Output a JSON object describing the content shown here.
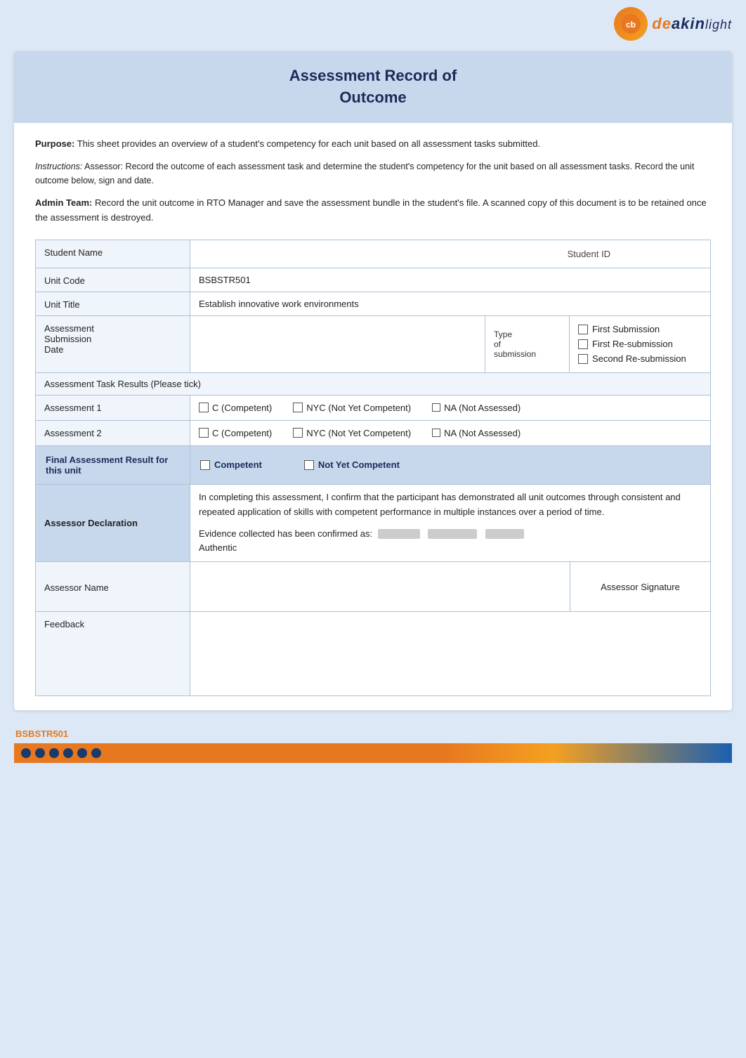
{
  "header": {
    "logo_text": "deakin"
  },
  "title": {
    "line1": "Assessment Record of",
    "line2": "Outcome"
  },
  "purpose": {
    "label": "Purpose:",
    "text": " This sheet provides an overview of a student's competency for each unit based on all assessment tasks submitted."
  },
  "instructions": {
    "label": "Instructions:",
    "assessor_label": " Assessor:",
    "text": " Record the outcome of each assessment task and determine the student's competency for the unit based on all assessment tasks. Record the unit outcome below, sign and date."
  },
  "admin": {
    "label": "Admin Team:",
    "text": " Record the unit outcome in RTO Manager and save the assessment bundle in the student's file. A scanned copy of this document is to be retained once the assessment is destroyed."
  },
  "form": {
    "student_name_label": "Student Name",
    "student_id_label": "Student ID",
    "unit_code_label": "Unit Code",
    "unit_code_value": "BSBSTR501",
    "unit_title_label": "Unit Title",
    "unit_title_value": "Establish innovative work environments",
    "assessment_submission_date_label": "Assessment Submission Date",
    "type_submission_label": "Type",
    "of_label": "of",
    "submission_label": "submission",
    "submission_options": [
      {
        "label": "First Submission",
        "checked": false
      },
      {
        "label": "First Re-submission",
        "checked": false
      },
      {
        "label": "Second Re-submission",
        "checked": false
      }
    ],
    "task_results_label": "Assessment Task Results (Please tick)",
    "assessment1_label": "Assessment 1",
    "assessment2_label": "Assessment 2",
    "option_c": "C (Competent)",
    "option_nyc": "NYC (Not Yet Competent)",
    "option_na": "NA (Not Assessed)",
    "final_result_label": "Final Assessment Result for this unit",
    "final_competent": "Competent",
    "final_nyc": "Not Yet Competent",
    "assessor_declaration_label": "Assessor Declaration",
    "declaration_text1": "In completing this assessment, I confirm that the participant has demonstrated all unit outcomes through consistent and repeated application of skills with competent performance in multiple instances over a period of time.",
    "declaration_text2": "Evidence collected has been confirmed as:",
    "declaration_text3": "Authentic",
    "assessor_name_label": "Assessor Name",
    "assessor_signature_label": "Assessor Signature",
    "feedback_label": "Feedback"
  },
  "footer": {
    "code": "BSBSTR501"
  }
}
